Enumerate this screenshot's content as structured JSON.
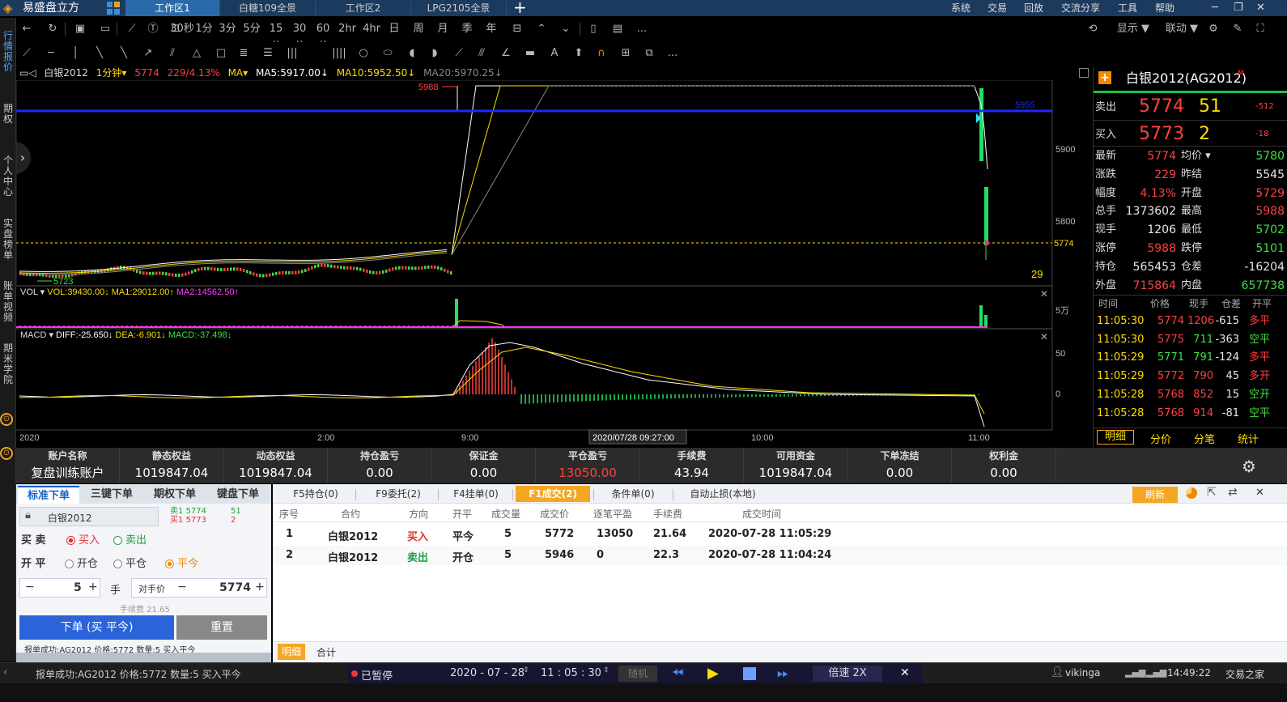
{
  "app": {
    "name": "易盛盘立方"
  },
  "tabs": [
    "工作区1",
    "白糖109全景",
    "工作区2",
    "LPG2105全景"
  ],
  "sysmenu": [
    "系统",
    "交易",
    "回放",
    "交流分享",
    "工具",
    "帮助"
  ],
  "toolbar": {
    "periods": [
      "30秒",
      "1分",
      "3分",
      "5分",
      "15分",
      "30分",
      "60分",
      "2hr",
      "4hr",
      "日",
      "周",
      "月",
      "季",
      "年"
    ],
    "right": [
      "显示 ▼",
      "联动 ▼"
    ],
    "more": "..."
  },
  "sidebar": [
    "行情报价",
    "期权",
    "个人中心",
    "实盘榜单",
    "账单视频",
    "期米学院"
  ],
  "chart": {
    "symbol": "白银2012",
    "period": "1分钟",
    "price": "5774",
    "change": "229/4.13%",
    "ma_label": "MA",
    "ma5": "MA5:5917.00↓",
    "ma10": "MA10:5952.50↓",
    "ma20": "MA20:5970.25↓",
    "high_mark": "5988",
    "low_mark": "5723",
    "line_mark": "5955",
    "cur_mark": "5774",
    "y_labels": [
      "5900",
      "5800"
    ],
    "counter": "29",
    "vol": {
      "name": "VOL",
      "vol": "VOL:39430.00↓",
      "ma1": "MA1:29012.00↑",
      "ma2": "MA2:14562.50↑",
      "ylabel": "5万"
    },
    "macd": {
      "name": "MACD",
      "diff": "DIFF:-25.650↓",
      "dea": "DEA:-6.901↓",
      "macd": "MACD:-37.498↓",
      "y_labels": [
        "50",
        "0"
      ]
    },
    "x_labels": [
      "2020",
      "2:00",
      "9:00",
      "2020/07/28 09:27:00",
      "10:00",
      "11:00"
    ]
  },
  "quote": {
    "title": "白银2012(AG2012)",
    "sup": "M",
    "sell": {
      "label": "卖出",
      "price": "5774",
      "qty": "51",
      "chg": "-512"
    },
    "buy": {
      "label": "买入",
      "price": "5773",
      "qty": "2",
      "chg": "-18"
    },
    "stats": [
      [
        "最新",
        "5774",
        "均价 ▾",
        "5780"
      ],
      [
        "涨跌",
        "229",
        "昨结",
        "5545"
      ],
      [
        "幅度",
        "4.13%",
        "开盘",
        "5729"
      ],
      [
        "总手",
        "1373602",
        "最高",
        "5988"
      ],
      [
        "现手",
        "1206",
        "最低",
        "5702"
      ],
      [
        "涨停",
        "5988",
        "跌停",
        "5101"
      ],
      [
        "持仓",
        "565453",
        "仓差",
        "-16204"
      ],
      [
        "外盘",
        "715864",
        "内盘",
        "657738"
      ]
    ],
    "tick_header": [
      "时间",
      "价格",
      "现手",
      "仓差",
      "开平"
    ],
    "ticks": [
      [
        "11:05:30",
        "5774",
        "1206",
        "-615",
        "多平"
      ],
      [
        "11:05:30",
        "5775",
        "711",
        "-363",
        "空平"
      ],
      [
        "11:05:29",
        "5771",
        "791",
        "-124",
        "多平"
      ],
      [
        "11:05:29",
        "5772",
        "790",
        "45",
        "多开"
      ],
      [
        "11:05:28",
        "5768",
        "852",
        "15",
        "空开"
      ],
      [
        "11:05:28",
        "5768",
        "914",
        "-81",
        "空平"
      ]
    ],
    "bottom_tabs": [
      "明细",
      "分价",
      "分笔",
      "统计"
    ]
  },
  "account": {
    "headers": [
      "账户名称",
      "静态权益",
      "动态权益",
      "持仓盈亏",
      "保证金",
      "平仓盈亏",
      "手续费",
      "可用资金",
      "下单冻结",
      "权利金"
    ],
    "values": [
      "复盘训练账户",
      "1019847.04",
      "1019847.04",
      "0.00",
      "0.00",
      "13050.00",
      "43.94",
      "1019847.04",
      "0.00",
      "0.00"
    ]
  },
  "order": {
    "tabs": [
      "标准下单",
      "三键下单",
      "期权下单",
      "键盘下单"
    ],
    "symbol": "白银2012",
    "sell1": "卖1",
    "sell1_price": "5774",
    "sell1_qty": "51",
    "buy1": "买1",
    "buy1_price": "5773",
    "buy1_qty": "2",
    "dir_label": "买 卖",
    "buy": "买入",
    "sell": "卖出",
    "oc_label": "开 平",
    "open": "开仓",
    "close": "平仓",
    "close_today": "平今",
    "qty": "5",
    "unit": "手",
    "price_type": "对手价",
    "price": "5774",
    "fee": "手续费 21.65",
    "submit": "下单 (买 平今)",
    "reset": "重置",
    "msg": "报单成功:AG2012 价格:5772 数量:5 买入平今"
  },
  "list": {
    "tabs": [
      "F5持仓(0)",
      "F9委托(2)",
      "F4挂单(0)",
      "F1成交(2)",
      "条件单(0)",
      "自动止损(本地)"
    ],
    "refresh": "刷新",
    "headers": [
      "序号",
      "合约",
      "方向",
      "开平",
      "成交量",
      "成交价",
      "逐笔平盈",
      "手续费",
      "成交时间"
    ],
    "rows": [
      [
        "1",
        "白银2012",
        "买入",
        "平今",
        "5",
        "5772",
        "13050",
        "21.64",
        "2020-07-28 11:05:29"
      ],
      [
        "2",
        "白银2012",
        "卖出",
        "开仓",
        "5",
        "5946",
        "0",
        "22.3",
        "2020-07-28 11:04:24"
      ]
    ],
    "bottom_tabs": [
      "明细",
      "合计"
    ]
  },
  "status": {
    "msg": "报单成功:AG2012 价格:5772 数量:5 买入平今",
    "paused": "已暂停",
    "date": "2020 - 07 - 28",
    "time": "11 : 05 : 30",
    "random": "随机",
    "speed": "倍速 2X",
    "user": "vikinga",
    "clock": "14:49:22",
    "brand": "交易之家"
  }
}
